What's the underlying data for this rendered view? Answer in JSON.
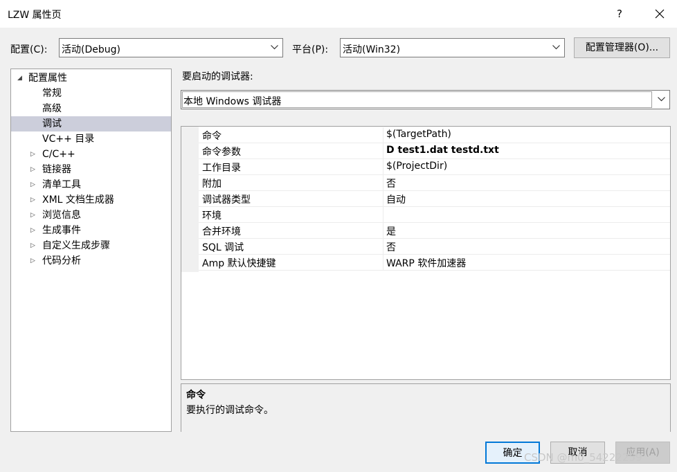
{
  "window": {
    "title": "LZW 属性页",
    "help": "?"
  },
  "config": {
    "label": "配置(C):",
    "value": "活动(Debug)",
    "platform_label": "平台(P):",
    "platform_value": "活动(Win32)",
    "manager_button": "配置管理器(O)..."
  },
  "tree": {
    "items": [
      {
        "label": "配置属性",
        "expander": "◢"
      },
      {
        "label": "常规"
      },
      {
        "label": "高级"
      },
      {
        "label": "调试"
      },
      {
        "label": "VC++ 目录"
      },
      {
        "label": "C/C++",
        "expander": "▷"
      },
      {
        "label": "链接器",
        "expander": "▷"
      },
      {
        "label": "清单工具",
        "expander": "▷"
      },
      {
        "label": "XML 文档生成器",
        "expander": "▷"
      },
      {
        "label": "浏览信息",
        "expander": "▷"
      },
      {
        "label": "生成事件",
        "expander": "▷"
      },
      {
        "label": "自定义生成步骤",
        "expander": "▷"
      },
      {
        "label": "代码分析",
        "expander": "▷"
      }
    ]
  },
  "debugger": {
    "label": "要启动的调试器:",
    "value": "本地 Windows 调试器"
  },
  "properties": [
    {
      "name": "命令",
      "value": "$(TargetPath)"
    },
    {
      "name": "命令参数",
      "value": "D test1.dat testd.txt"
    },
    {
      "name": "工作目录",
      "value": "$(ProjectDir)"
    },
    {
      "name": "附加",
      "value": "否"
    },
    {
      "name": "调试器类型",
      "value": "自动"
    },
    {
      "name": "环境",
      "value": ""
    },
    {
      "name": "合并环境",
      "value": "是"
    },
    {
      "name": "SQL 调试",
      "value": "否"
    },
    {
      "name": "Amp 默认快捷键",
      "value": "WARP 软件加速器"
    }
  ],
  "description": {
    "title": "命令",
    "text": "要执行的调试命令。"
  },
  "buttons": {
    "ok": "确定",
    "cancel": "取消",
    "apply": "应用(A)"
  },
  "watermark": "CSDN @m0_54222259"
}
